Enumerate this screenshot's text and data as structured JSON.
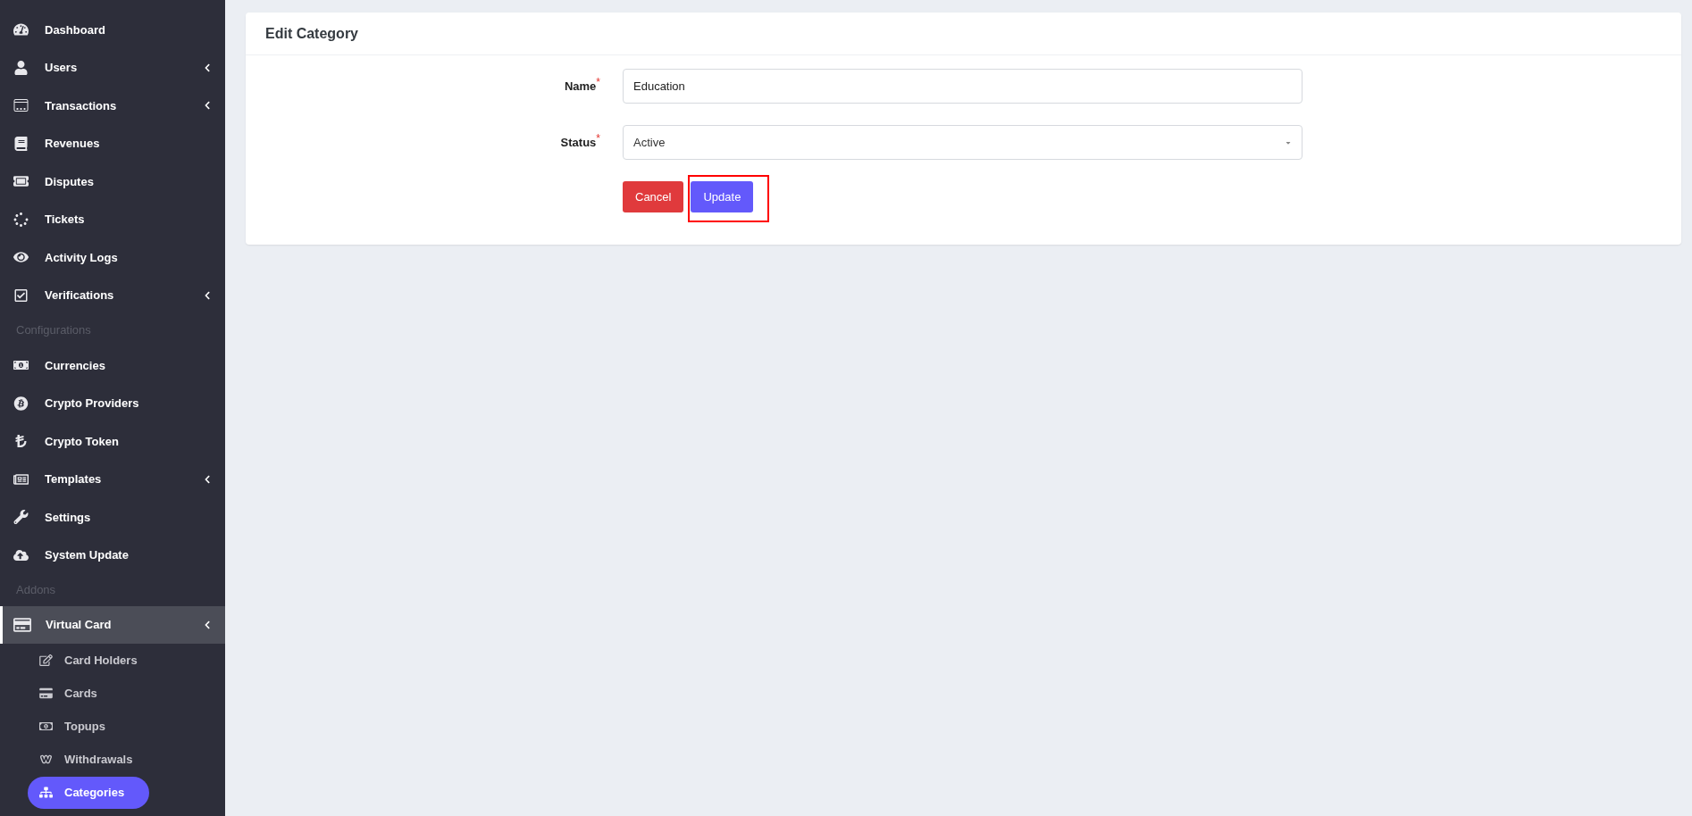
{
  "sidebar": {
    "items": [
      {
        "kind": "item",
        "label": "Dashboard",
        "has_submenu": false,
        "selected": false
      },
      {
        "kind": "item",
        "label": "Users",
        "has_submenu": true,
        "selected": false
      },
      {
        "kind": "item",
        "label": "Transactions",
        "has_submenu": true,
        "selected": false
      },
      {
        "kind": "item",
        "label": "Revenues",
        "has_submenu": false,
        "selected": false
      },
      {
        "kind": "item",
        "label": "Disputes",
        "has_submenu": false,
        "selected": false
      },
      {
        "kind": "item",
        "label": "Tickets",
        "has_submenu": false,
        "selected": false
      },
      {
        "kind": "item",
        "label": "Activity Logs",
        "has_submenu": false,
        "selected": false
      },
      {
        "kind": "item",
        "label": "Verifications",
        "has_submenu": true,
        "selected": false
      },
      {
        "kind": "header",
        "label": "Configurations"
      },
      {
        "kind": "item",
        "label": "Currencies",
        "has_submenu": false,
        "selected": false
      },
      {
        "kind": "item",
        "label": "Crypto Providers",
        "has_submenu": false,
        "selected": false
      },
      {
        "kind": "item",
        "label": "Crypto Token",
        "has_submenu": false,
        "selected": false
      },
      {
        "kind": "item",
        "label": "Templates",
        "has_submenu": true,
        "selected": false
      },
      {
        "kind": "item",
        "label": "Settings",
        "has_submenu": false,
        "selected": false
      },
      {
        "kind": "item",
        "label": "System Update",
        "has_submenu": false,
        "selected": false
      },
      {
        "kind": "header",
        "label": "Addons"
      },
      {
        "kind": "item",
        "label": "Virtual Card",
        "has_submenu": true,
        "selected": true,
        "children": [
          {
            "label": "Card Holders",
            "selected": false
          },
          {
            "label": "Cards",
            "selected": false
          },
          {
            "label": "Topups",
            "selected": false
          },
          {
            "label": "Withdrawals",
            "selected": false
          },
          {
            "label": "Categories",
            "selected": true
          }
        ]
      }
    ]
  },
  "card": {
    "title": "Edit Category",
    "fields": [
      {
        "kind": "text",
        "label": "Name",
        "required_mark": "*",
        "value": "Education"
      },
      {
        "kind": "select",
        "label": "Status",
        "required_mark": "*",
        "value": "Active"
      }
    ],
    "buttons": [
      {
        "kind": "cancel",
        "label": "Cancel",
        "highlighted": false
      },
      {
        "kind": "primary",
        "label": "Update",
        "highlighted": true
      }
    ]
  }
}
